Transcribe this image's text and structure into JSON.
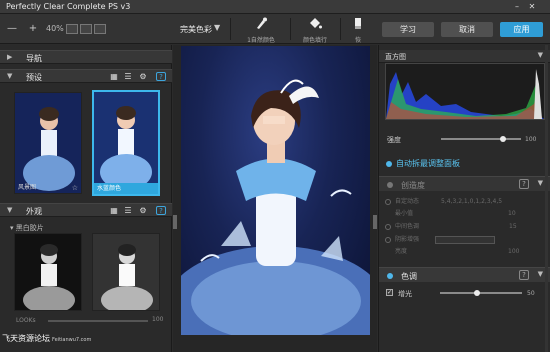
{
  "window": {
    "title": "Perfectly Clear Complete PS v3"
  },
  "toolbar": {
    "minus": "—",
    "plus": "+",
    "zoom": "40%",
    "preset_name": "完美色彩",
    "preset_arrow": "▼",
    "tools": [
      {
        "icon": "brush-icon",
        "label": "1自然颜色"
      },
      {
        "icon": "paint-bucket-icon",
        "label": "颜色填行"
      },
      {
        "icon": "eraser-icon",
        "label": "恢"
      }
    ],
    "buttons": {
      "learn": "学习",
      "cancel": "取消",
      "apply": "应用"
    }
  },
  "left_panel": {
    "nav_label": "导航",
    "presets_label": "预设",
    "presets": [
      {
        "caption": "风景图",
        "star": "☆"
      },
      {
        "caption": "水蓝颜色",
        "star": ""
      }
    ],
    "looks_label": "外观",
    "looks_category": "黑白胶片",
    "look_slider_label": "LOOKs",
    "look_slider_value": "100"
  },
  "right_panel": {
    "histogram_label": "直方图",
    "strength_label": "强度",
    "strength_value": "100",
    "strength_level": 0.78,
    "auto_label": "自动拆最调整面板",
    "sub_sections": [
      {
        "name": "创造度",
        "help": "?",
        "caret": "▼"
      }
    ],
    "dim_rows": [
      {
        "label": "自定动态",
        "value": "5,4,3,2,1,0,1,2,3,4,5"
      },
      {
        "label": "最小值",
        "value": "10"
      },
      {
        "label": "中间色调",
        "value": "15"
      },
      {
        "label": "阴影增强",
        "value": ""
      },
      {
        "label": "亮度",
        "value": "100"
      }
    ],
    "color_section": {
      "name": "色调",
      "help": "?",
      "caret": "▼"
    },
    "vivid_label": "增光",
    "vivid_value": "50",
    "vivid_level": 0.45
  },
  "watermark": {
    "cn": "飞天资源论坛",
    "en": "Feitianwu7.com"
  }
}
